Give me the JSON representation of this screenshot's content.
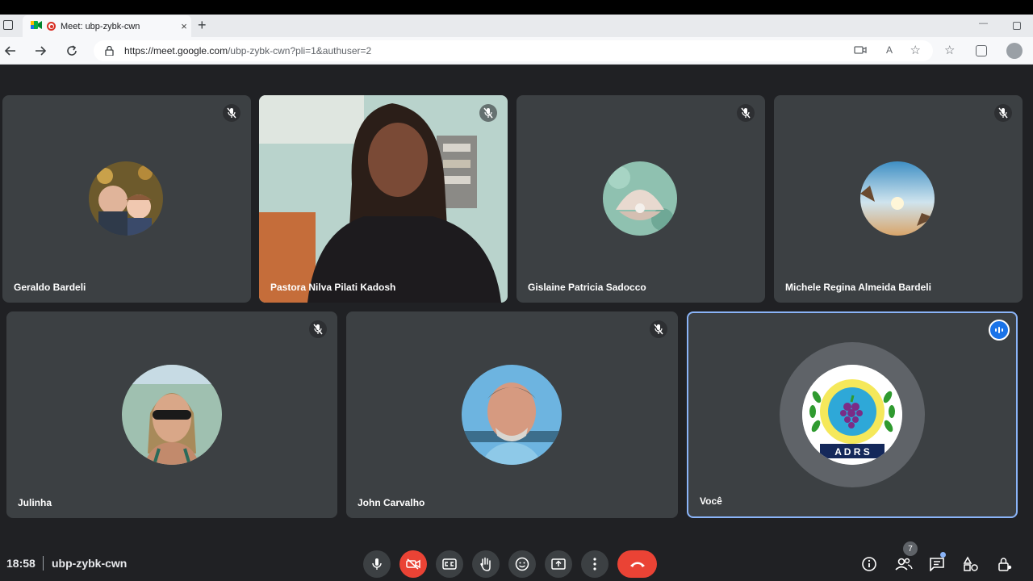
{
  "browser": {
    "tab_title": "Meet: ubp-zybk-cwn",
    "tab_close": "×",
    "new_tab": "+",
    "url_host": "https://meet.google.com",
    "url_path": "/ubp-zybk-cwn?pli=1&authuser=2",
    "window_min": "—"
  },
  "participants": [
    {
      "name": "Geraldo Bardeli",
      "muted": true
    },
    {
      "name": "Pastora Nilva Pilati Kadosh",
      "muted": true
    },
    {
      "name": "Gislaine Patricia Sadocco",
      "muted": true
    },
    {
      "name": "Michele Regina Almeida Bardeli",
      "muted": true
    },
    {
      "name": "Julinha",
      "muted": true
    },
    {
      "name": "John Carvalho",
      "muted": true
    },
    {
      "name": "Você",
      "muted": false
    }
  ],
  "self_logo_text": "A D R S",
  "bottom": {
    "time": "18:58",
    "meeting_code": "ubp-zybk-cwn",
    "people_count": "7"
  },
  "colors": {
    "background": "#202124",
    "tile": "#3c4043",
    "danger": "#ea4335",
    "accent": "#8ab4f8"
  }
}
